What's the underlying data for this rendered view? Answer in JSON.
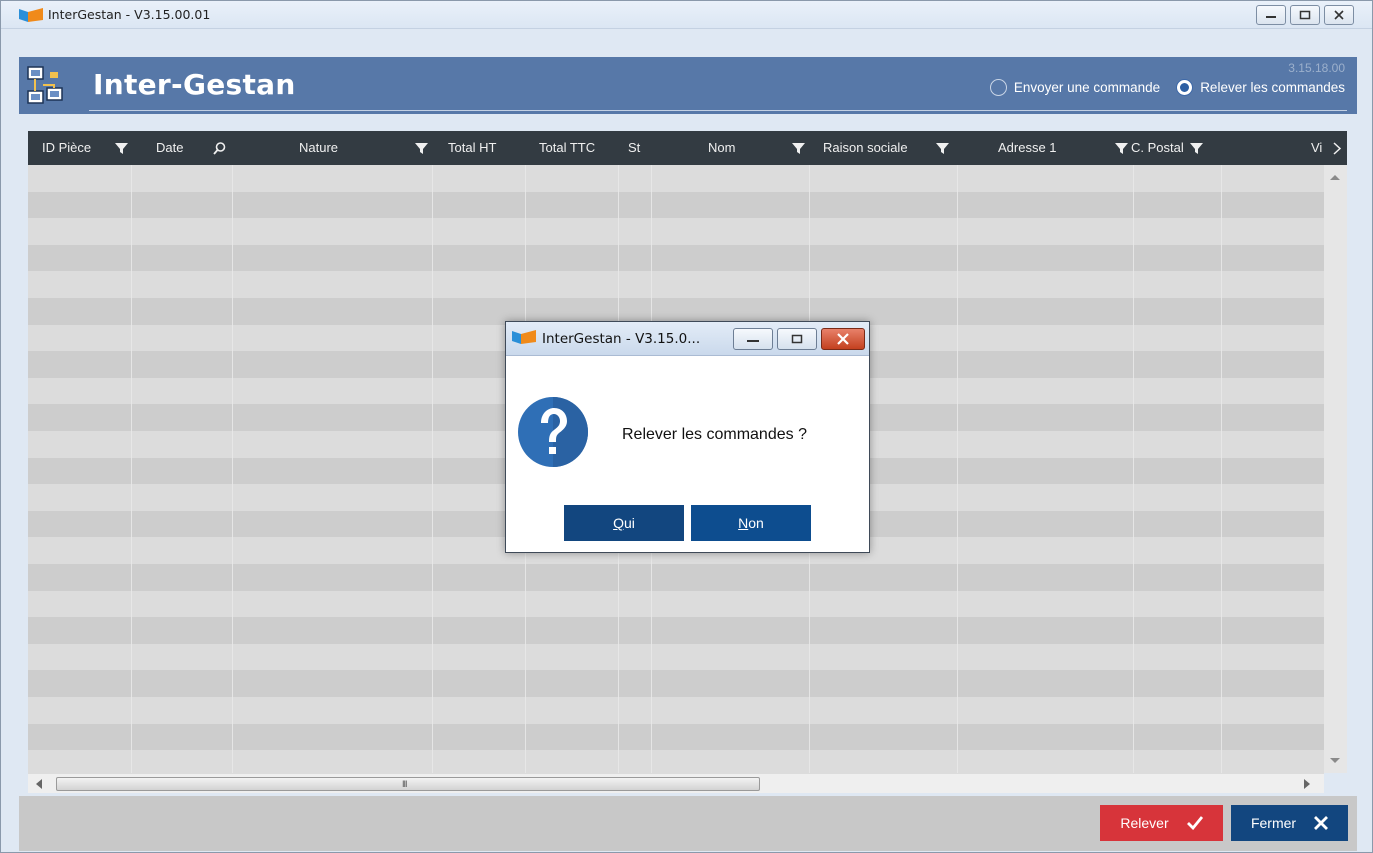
{
  "window": {
    "title": "InterGestan - V3.15.00.01"
  },
  "banner": {
    "title": "Inter-Gestan",
    "version": "3.15.18.00",
    "radio_send": "Envoyer une commande",
    "radio_receive": "Relever les commandes",
    "selected": "receive"
  },
  "grid": {
    "columns": [
      {
        "label": "ID Pièce",
        "icon": "filter-icon"
      },
      {
        "label": "Date",
        "icon": "search-icon"
      },
      {
        "label": "Nature",
        "icon": "filter-icon"
      },
      {
        "label": "Total HT",
        "icon": ""
      },
      {
        "label": "Total TTC",
        "icon": ""
      },
      {
        "label": "St",
        "icon": ""
      },
      {
        "label": "Nom",
        "icon": "filter-icon"
      },
      {
        "label": "Raison sociale",
        "icon": "filter-icon"
      },
      {
        "label": "Adresse 1",
        "icon": "filter-icon"
      },
      {
        "label": "C. Postal",
        "icon": "filter-icon"
      },
      {
        "label": "Vi",
        "icon": "chevron-right-icon"
      }
    ],
    "scroll_grip": "III"
  },
  "footer": {
    "relever_label": "Relever",
    "fermer_label": "Fermer"
  },
  "dialog": {
    "title": "InterGestan - V3.15.0...",
    "message": "Relever les commandes ?",
    "yes_first": "Q",
    "yes_rest": "ui",
    "no_first": "N",
    "no_rest": "on"
  },
  "colors": {
    "banner": "#5778a8",
    "grid_header": "#333b42",
    "relever": "#d7343a",
    "fermer": "#12467f"
  }
}
